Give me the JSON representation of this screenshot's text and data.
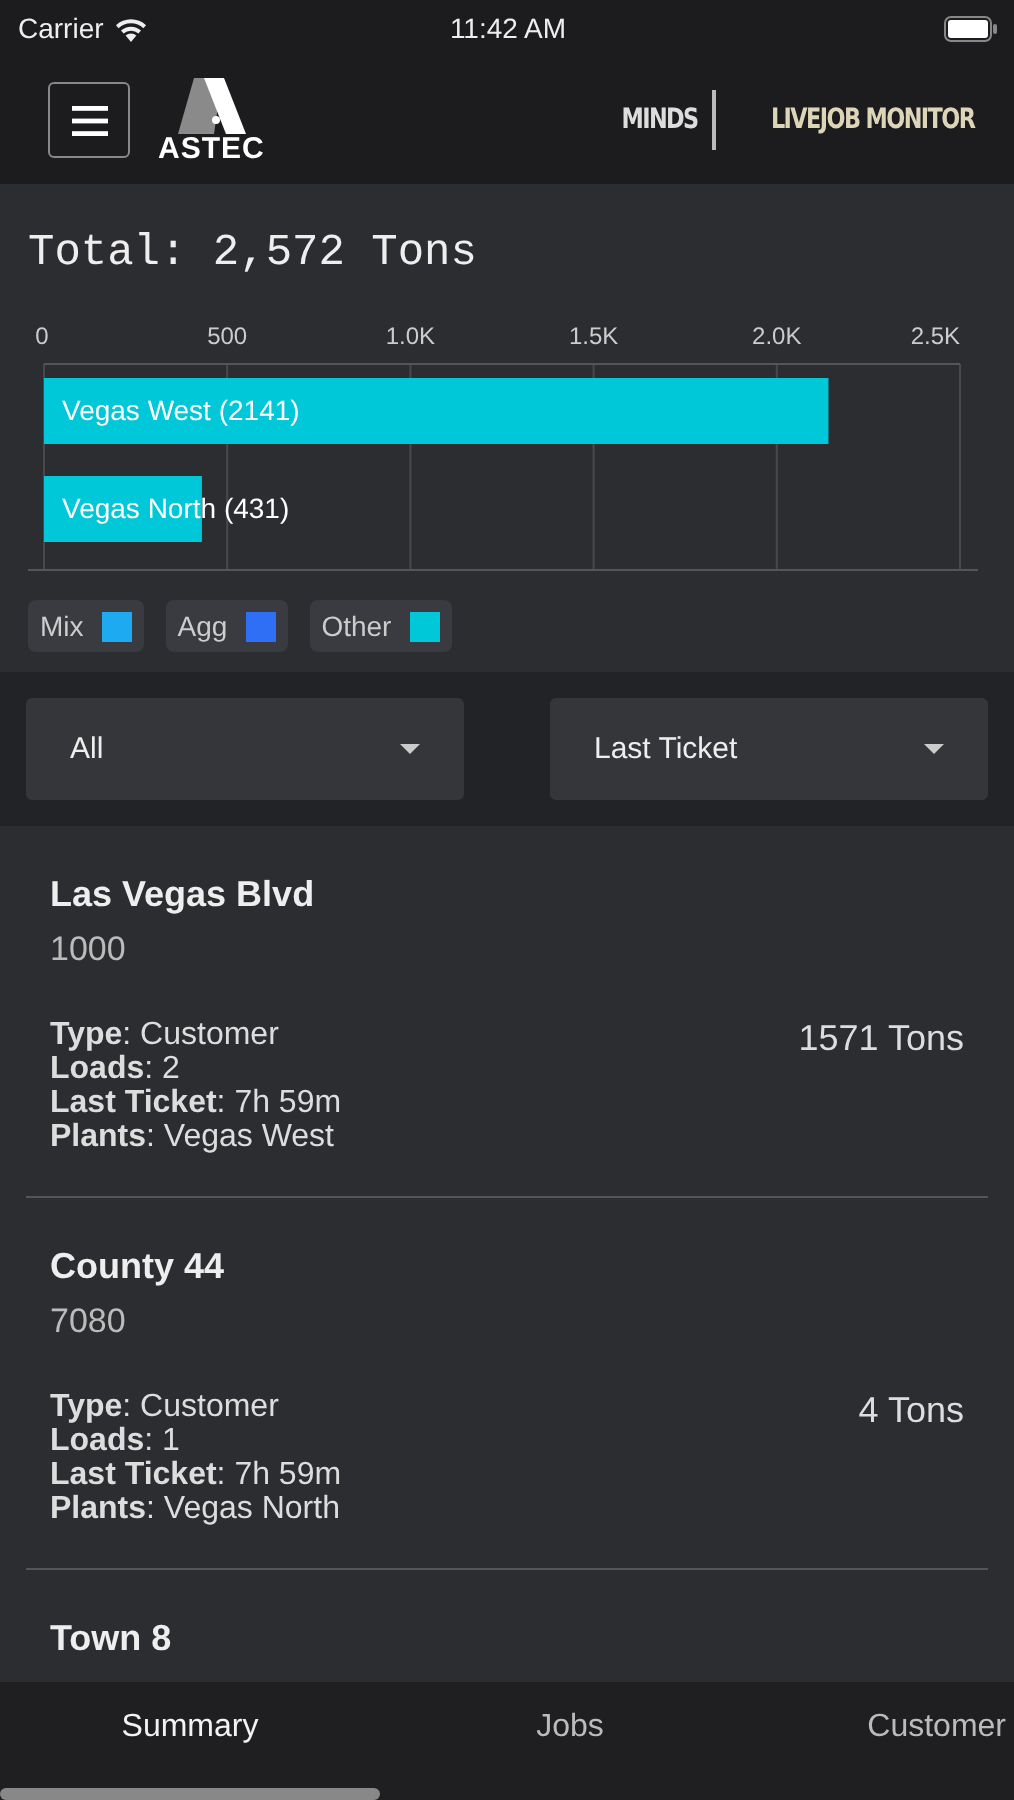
{
  "status_bar": {
    "carrier": "Carrier",
    "time": "11:42 AM"
  },
  "header": {
    "logo_text": "ASTEC",
    "product": "MINDS",
    "module": "LIVEJOB MONITOR"
  },
  "summary": {
    "total": "Total: 2,572 Tons",
    "chart_data": {
      "type": "bar",
      "orientation": "horizontal",
      "stacked": true,
      "grid": true,
      "series": [
        {
          "name": "Mix",
          "color": "#1eaaf0",
          "values": [
            0,
            0
          ]
        },
        {
          "name": "Agg",
          "color": "#2f6ff5",
          "values": [
            0,
            0
          ]
        },
        {
          "name": "Other",
          "color": "#00c8d8",
          "values": [
            2141,
            431
          ]
        }
      ],
      "xlim": [
        0,
        2500
      ],
      "xticks": [
        {
          "value": 0,
          "label": "0"
        },
        {
          "value": 500,
          "label": "500"
        },
        {
          "value": 1000,
          "label": "1.0K"
        },
        {
          "value": 1500,
          "label": "1.5K"
        },
        {
          "value": 2000,
          "label": "2.0K"
        },
        {
          "value": 2500,
          "label": "2.5K"
        }
      ],
      "value_labels": [
        "Vegas West (2141)",
        "Vegas North (431)"
      ]
    }
  },
  "filters": [
    {
      "value": "All"
    },
    {
      "value": "Last Ticket"
    }
  ],
  "jobs": [
    {
      "name": "Las Vegas Blvd",
      "number": "1000",
      "tons": "1571 Tons",
      "fields": [
        "**Type**: Customer",
        "**Loads**: 2",
        "**Last Ticket**: 7h 59m",
        "**Plants**: Vegas West"
      ]
    },
    {
      "name": "County 44",
      "number": "7080",
      "tons": "4 Tons",
      "fields": [
        "**Type**: Customer",
        "**Loads**: 1",
        "**Last Ticket**: 7h 59m",
        "**Plants**: Vegas North"
      ]
    },
    {
      "name": "Town 8"
    }
  ],
  "tabs": [
    {
      "label": "Summary",
      "selected": true
    },
    {
      "label": "Jobs",
      "selected": false
    },
    {
      "label": "Customer",
      "selected": false
    }
  ]
}
